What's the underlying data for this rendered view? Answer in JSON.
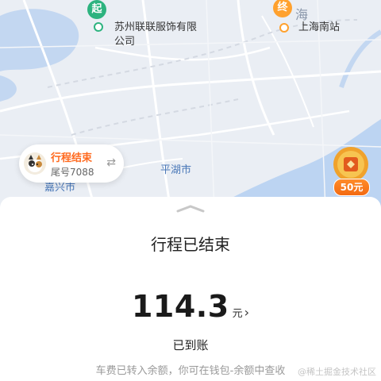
{
  "map": {
    "start_pin": "起",
    "start_label_line1": "苏州联联服饰有限",
    "start_label_line2": "公司",
    "end_pin": "终",
    "end_label": "上海南站",
    "city_label": "海",
    "district_label": "平湖市",
    "partial_label": "嘉兴市"
  },
  "trip_pill": {
    "status": "行程结束",
    "plate": "尾号7088",
    "swap_icon": "swap-icon"
  },
  "coupon": {
    "badge": "50元",
    "icon": "coin-icon"
  },
  "sheet": {
    "title": "行程已结束",
    "price": "114.3",
    "unit": "元",
    "chevron": "›",
    "paid": "已到账",
    "note": "车费已转入余额，你可在钱包-余额中查收"
  },
  "watermark": "@稀土掘金技术社区",
  "colors": {
    "start_pin": "#2db37f",
    "end_pin": "#ffa12e",
    "accent": "#ff6a1f",
    "water": "#bcd4f2"
  }
}
